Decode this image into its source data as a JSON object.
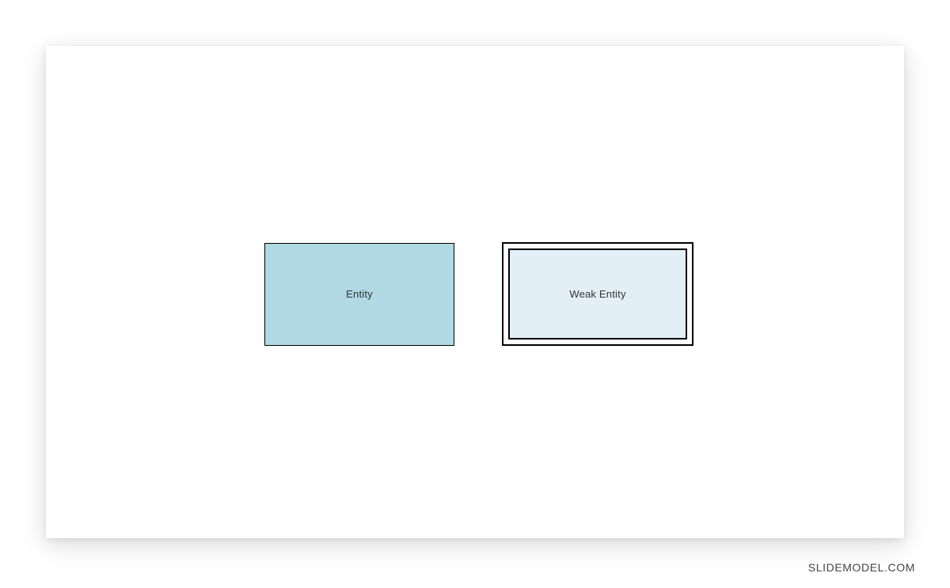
{
  "diagram": {
    "entity": {
      "label": "Entity"
    },
    "weak_entity": {
      "label": "Weak Entity"
    }
  },
  "watermark": "SLIDEMODEL.COM"
}
